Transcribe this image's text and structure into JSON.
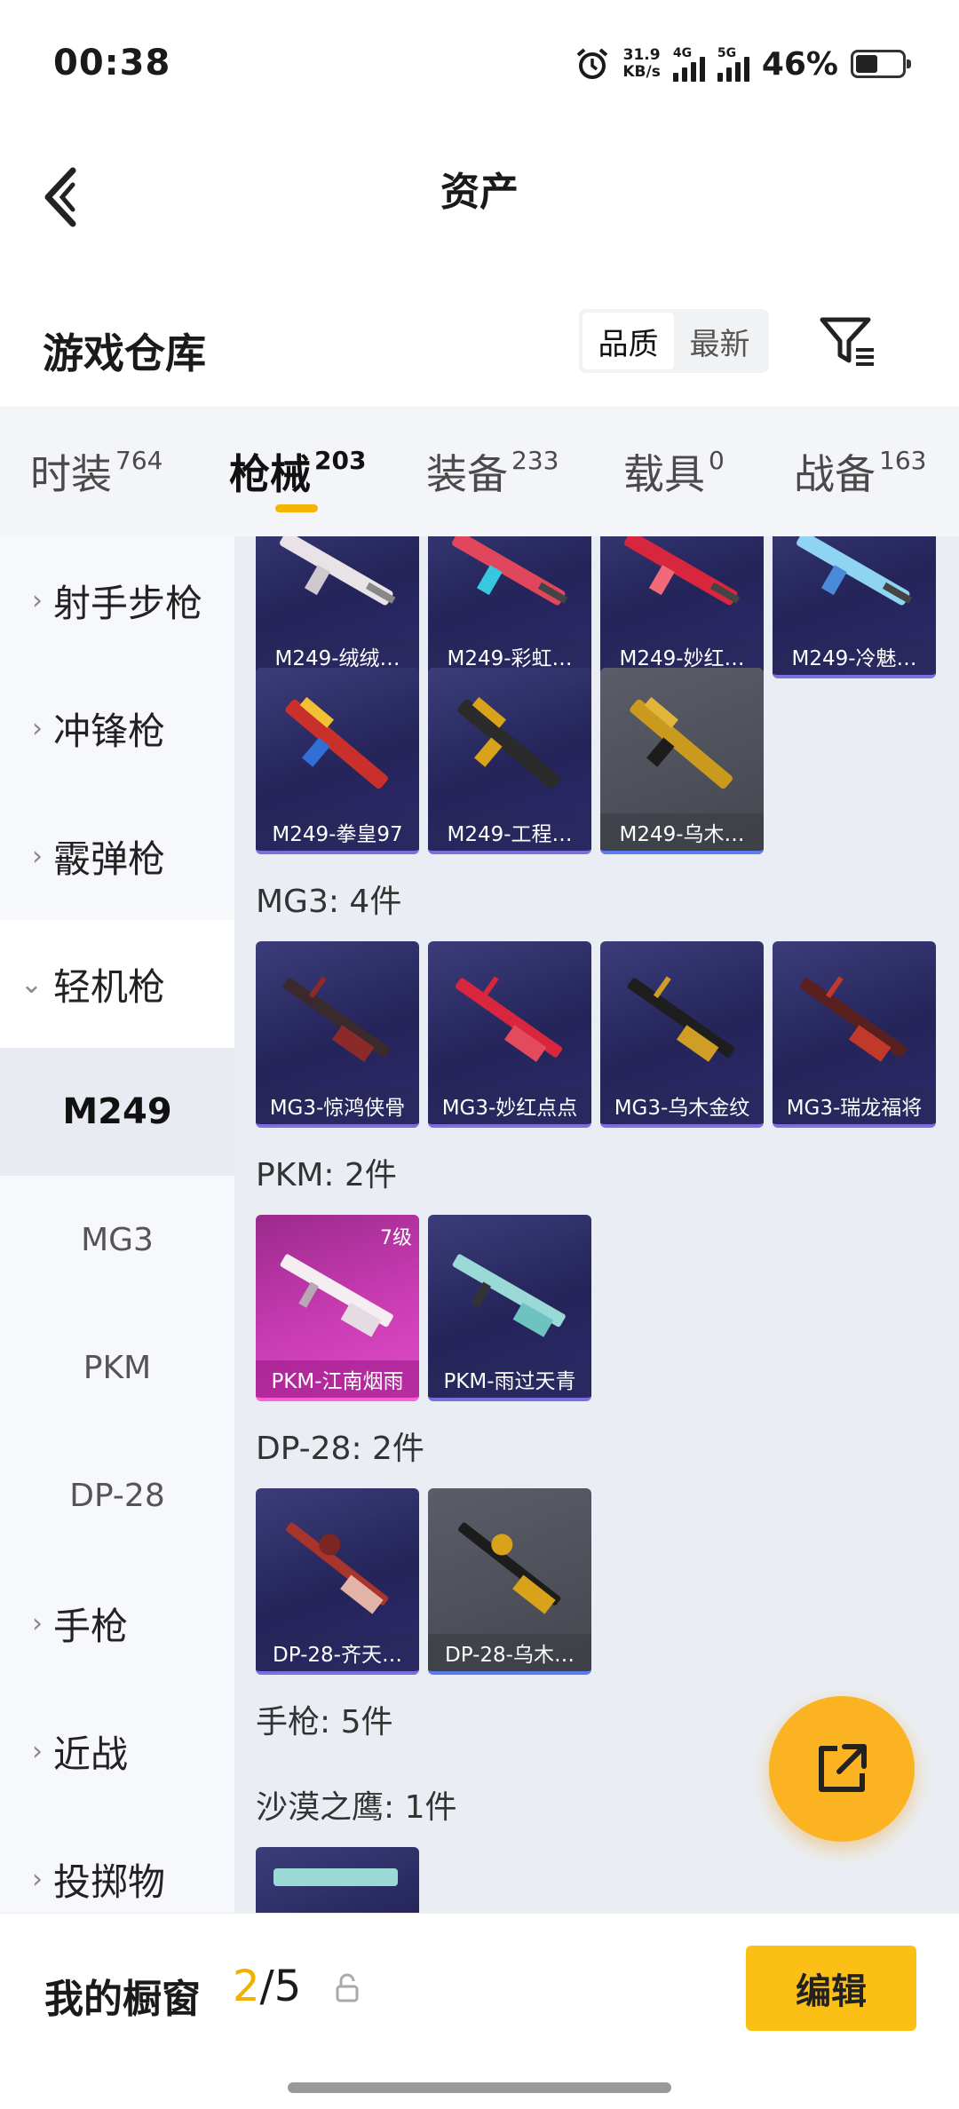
{
  "status_bar": {
    "time": "00:38",
    "net_speed_value": "31.9",
    "net_speed_unit": "KB/s",
    "sim1_label": "4G",
    "sim2_label": "5G",
    "battery": "46%",
    "battery_level": 0.46
  },
  "header": {
    "title": "资产"
  },
  "section": {
    "title": "游戏仓库",
    "sort_options": [
      "品质",
      "最新"
    ],
    "sort_selected": "品质"
  },
  "tabs": [
    {
      "label": "时装",
      "count": "764"
    },
    {
      "label": "枪械",
      "count": "203",
      "active": true
    },
    {
      "label": "装备",
      "count": "233"
    },
    {
      "label": "载具",
      "count": "0"
    },
    {
      "label": "战备",
      "count": "163"
    }
  ],
  "sidebar": {
    "items": [
      {
        "label": "射手步枪"
      },
      {
        "label": "冲锋枪"
      },
      {
        "label": "霰弹枪"
      },
      {
        "label": "轻机枪",
        "expanded": true
      },
      {
        "label": "手枪"
      },
      {
        "label": "近战"
      },
      {
        "label": "投掷物"
      }
    ],
    "sub_items": [
      {
        "label": "M249",
        "active": true
      },
      {
        "label": "MG3"
      },
      {
        "label": "PKM"
      },
      {
        "label": "DP-28"
      }
    ]
  },
  "content": {
    "m249_row1": [
      "M249-绒绒…",
      "M249-彩虹…",
      "M249-妙红…",
      "M249-冷魅…"
    ],
    "m249_row2": [
      "M249-拳皇97",
      "M249-工程…",
      "M249-乌木…"
    ],
    "groups": [
      {
        "title": "MG3: 4件",
        "items": [
          "MG3-惊鸿侠骨",
          "MG3-妙红点点",
          "MG3-乌木金纹",
          "MG3-瑞龙福将"
        ]
      },
      {
        "title": "PKM: 2件",
        "items": [
          "PKM-江南烟雨",
          "PKM-雨过天青"
        ],
        "level": "7级"
      },
      {
        "title": "DP-28: 2件",
        "items": [
          "DP-28-齐天…",
          "DP-28-乌木…"
        ]
      },
      {
        "title": "手枪: 5件"
      },
      {
        "title": "沙漠之鹰: 1件"
      }
    ]
  },
  "bottom_bar": {
    "showcase_label": "我的橱窗",
    "showcase_current": "2",
    "showcase_total": "/5",
    "edit_label": "编辑"
  },
  "colors": {
    "accent": "#f5b400",
    "card_purple": "#2a2a62",
    "card_pink": "#c63ab0",
    "card_gray": "#4f5159"
  }
}
